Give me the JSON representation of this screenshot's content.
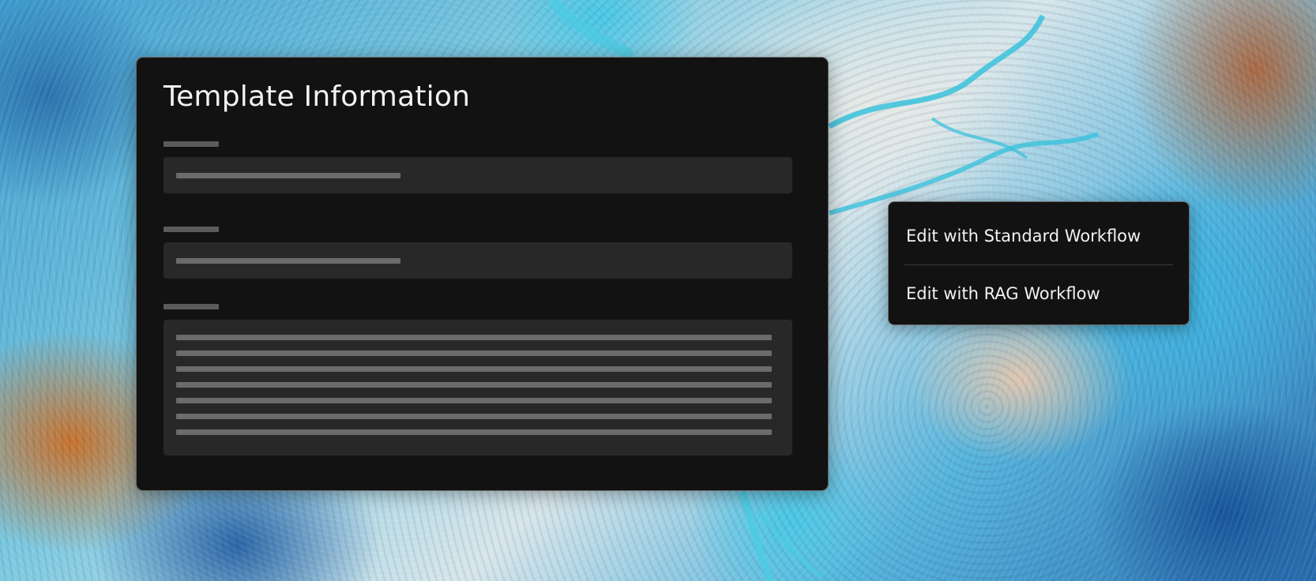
{
  "panel": {
    "title": "Template Information"
  },
  "menu": {
    "items": [
      {
        "label": "Edit with Standard Workflow"
      },
      {
        "label": "Edit with RAG Workflow"
      }
    ]
  }
}
